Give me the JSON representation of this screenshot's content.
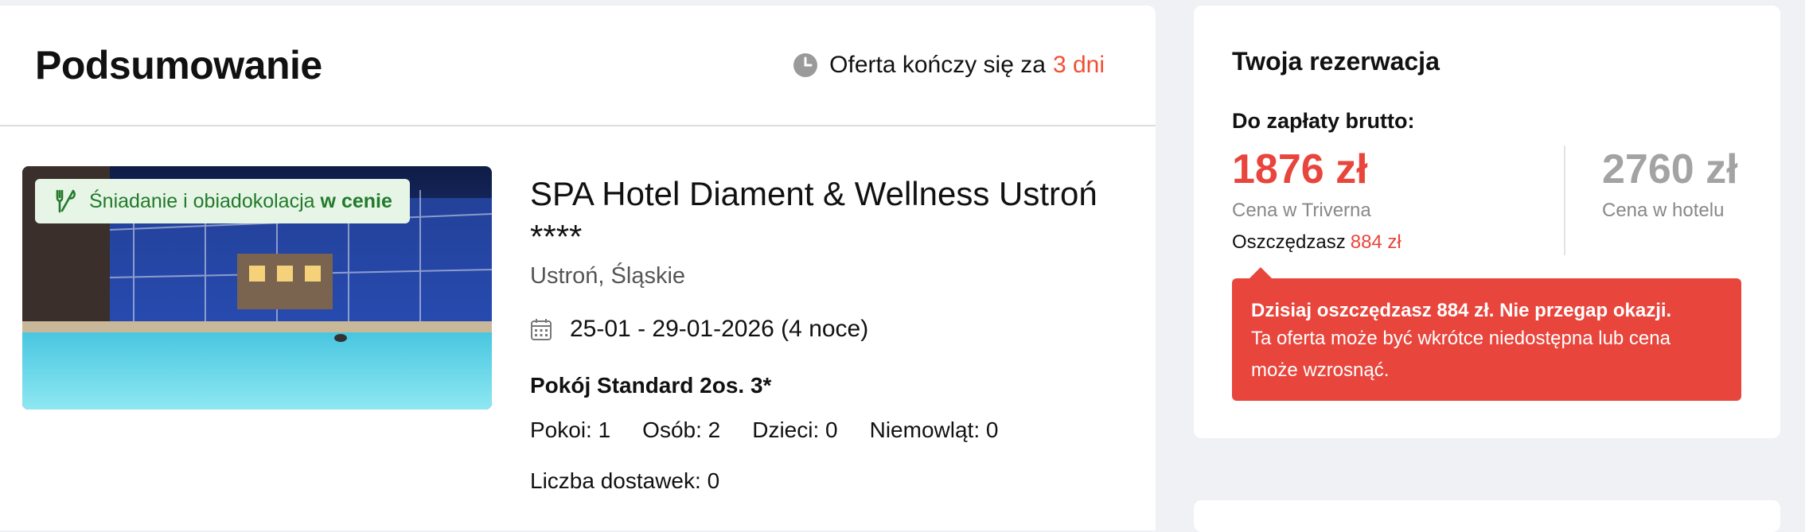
{
  "summary": {
    "title": "Podsumowanie",
    "offer_prefix": "Oferta kończy się za",
    "offer_days": "3 dni"
  },
  "hotel": {
    "badge_text": "Śniadanie i obiadokolacja",
    "badge_strong": "w cenie",
    "name": "SPA Hotel Diament & Wellness Ustroń ****",
    "location": "Ustroń, Śląskie",
    "dates": "25-01 - 29-01-2026 (4 noce)",
    "room": "Pokój Standard 2os. 3*",
    "counts": [
      "Pokoi: 1",
      "Osób: 2",
      "Dzieci: 0",
      "Niemowląt: 0"
    ],
    "extra_beds": "Liczba dostawek: 0"
  },
  "reservation": {
    "title": "Twoja rezerwacja",
    "subtitle": "Do zapłaty brutto:",
    "price_triverna": "1876 zł",
    "price_triverna_label": "Cena w Triverna",
    "savings_label": "Oszczędzasz",
    "savings_amount": "884 zł",
    "price_hotel": "2760 zł",
    "price_hotel_label": "Cena w hotelu",
    "alert_strong": "Dzisiaj oszczędzasz 884 zł. Nie przegap okazji.",
    "alert_text": "Ta oferta może być wkrótce niedostępna lub cena może wzrosnąć."
  },
  "colors": {
    "accent_red": "#e8453c",
    "offer_orange": "#ee5133",
    "badge_green": "#227a2a",
    "badge_bg": "#e6f5e6"
  },
  "icons": {
    "clock": "clock-icon",
    "cutlery": "cutlery-icon",
    "calendar": "calendar-icon"
  }
}
